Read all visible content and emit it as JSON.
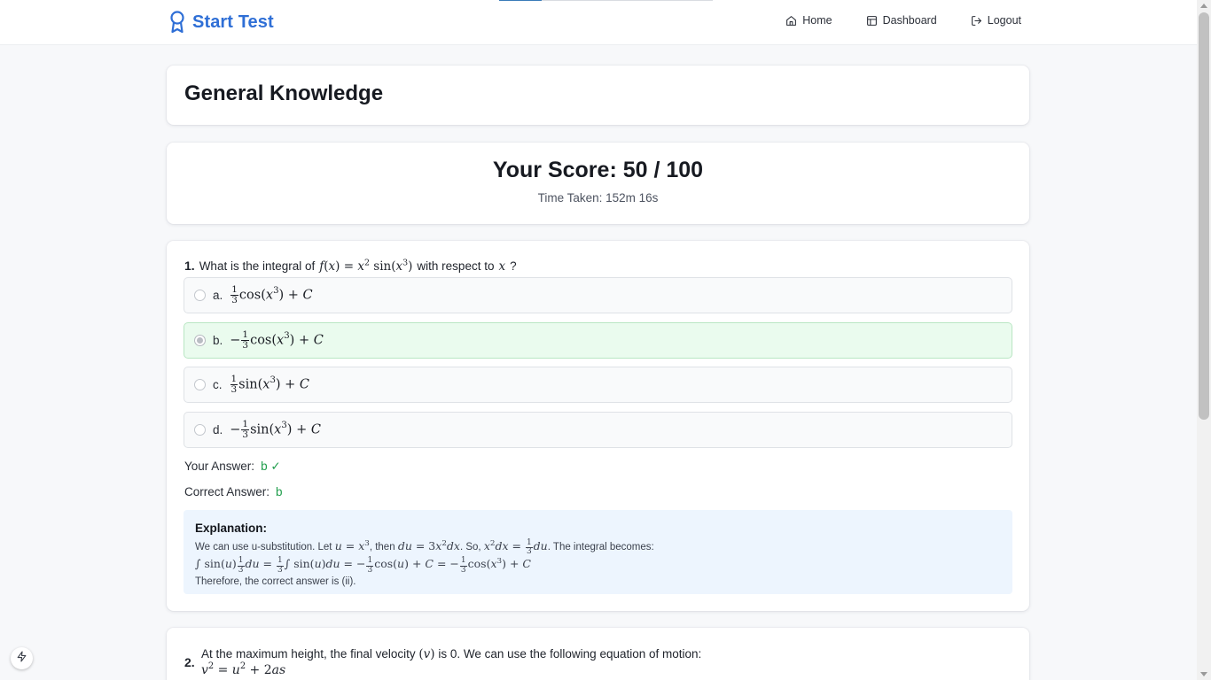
{
  "app": {
    "title": "Start Test"
  },
  "nav": {
    "home": "Home",
    "dashboard": "Dashboard",
    "logout": "Logout"
  },
  "test": {
    "title": "General Knowledge"
  },
  "score": {
    "text": "Your Score: 50 / 100",
    "time": "Time Taken: 152m 16s"
  },
  "q1": {
    "number": "1.",
    "prefix": "What is the integral of",
    "middle": "with respect to",
    "suffix": "?",
    "options": [
      {
        "letter": "a."
      },
      {
        "letter": "b."
      },
      {
        "letter": "c."
      },
      {
        "letter": "d."
      }
    ],
    "your_answer_label": "Your Answer:",
    "your_answer_value": "b ✓",
    "correct_answer_label": "Correct Answer:",
    "correct_answer_value": "b",
    "explanation": {
      "title": "Explanation:",
      "t1": "We can use u-substitution. Let",
      "t2": ", then",
      "t3": ". So,",
      "t4": ". The integral becomes:",
      "conclusion": "Therefore, the correct answer is (ii)."
    }
  },
  "q2": {
    "number": "2.",
    "t1": "At the maximum height, the final velocity",
    "t2": "is 0. We can use the following equation of motion:"
  },
  "colors": {
    "brand": "#2f6fd6",
    "correct_bg": "#eafbee",
    "explanation_bg": "#edf5fe",
    "answer_green": "#1f9d4b"
  },
  "progress": {
    "fraction": 0.2
  }
}
